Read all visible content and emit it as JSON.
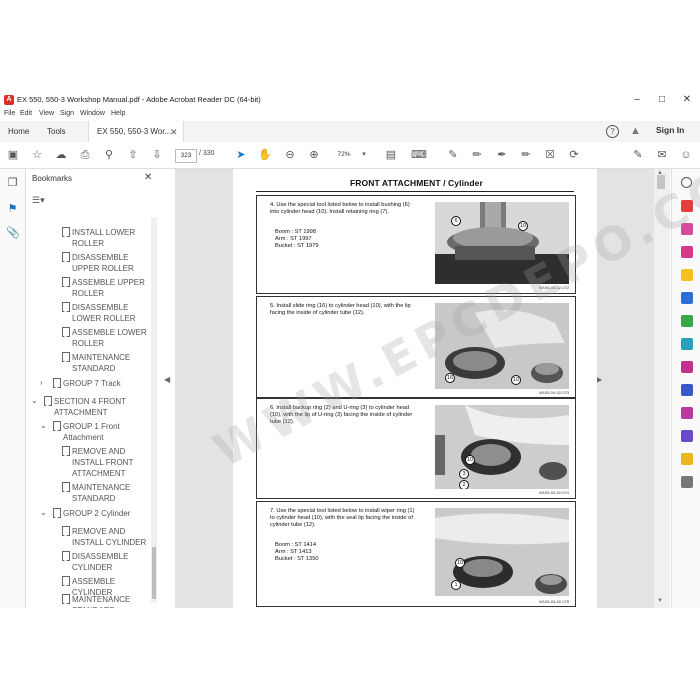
{
  "window": {
    "title": "EX 550, 550-3 Workshop Manual.pdf - Adobe Acrobat Reader DC (64-bit)",
    "minimize_icon": "minimize-icon",
    "maximize_icon": "maximize-icon",
    "close_icon": "close-icon"
  },
  "menu": [
    "File",
    "Edit",
    "View",
    "Sign",
    "Window",
    "Help"
  ],
  "tabs": {
    "home": "Home",
    "tools": "Tools",
    "document": "EX 550, 550-3 Wor...",
    "sign_in": "Sign In"
  },
  "toolbar": {
    "page_current": "323",
    "page_total": "/ 330",
    "zoom": "72%"
  },
  "bookmarks": {
    "title": "Bookmarks",
    "items": [
      {
        "label": "INSTALL LOWER ROLLER"
      },
      {
        "label": "DISASSEMBLE UPPER ROLLER"
      },
      {
        "label": "ASSEMBLE UPPER ROLLER"
      },
      {
        "label": "DISASSEMBLE LOWER ROLLER"
      },
      {
        "label": "ASSEMBLE LOWER ROLLER"
      },
      {
        "label": "MAINTENANCE STANDARD"
      },
      {
        "label": "GROUP 7 Track"
      },
      {
        "label": "SECTION 4 FRONT ATTACHMENT"
      },
      {
        "label": "GROUP 1 Front Attachment"
      },
      {
        "label": "REMOVE AND INSTALL FRONT ATTACHMENT"
      },
      {
        "label": "MAINTENANCE STANDARD"
      },
      {
        "label": "GROUP 2 Cylinder"
      },
      {
        "label": "REMOVE AND INSTALL CYLINDER"
      },
      {
        "label": "DISASSEMBLE CYLINDER"
      },
      {
        "label": "ASSEMBLE CYLINDER"
      },
      {
        "label": "MAINTENANCE STANDARD"
      }
    ]
  },
  "document": {
    "header": "FRONT ATTACHMENT / Cylinder",
    "steps": [
      {
        "text": "4. Use the special tool listed below to install bushing (6) into cylinder head (10). Install retaining ring (7).",
        "tools": [
          "Boom   : ST 1998",
          "Arm     : ST 1997",
          "Bucket : ST 1979"
        ],
        "callouts": [
          "6",
          "10"
        ],
        "caption": "W105-04-02-072"
      },
      {
        "text": "5. Install slide ring (16) to cylinder head (10), with the lip facing the inside of cylinder tube (12).",
        "tools": [],
        "callouts": [
          "16",
          "10"
        ],
        "caption": "W105-04-02-073"
      },
      {
        "text": "6. Install backup ring (2) and U-ring (3) to cylinder head (10), with the lip of U-ring (3) facing the inside of cylinder tube (12).",
        "tools": [],
        "callouts": [
          "10",
          "3",
          "2"
        ],
        "caption": "W105-04-02-074"
      },
      {
        "text": "7. Use the special tool listed below to install wiper ring (1) to cylinder head (10), with the seal lip facing the inside of cylinder tube (12).",
        "tools": [
          "Boom   : ST 1414",
          "Arm     : ST 1413",
          "Bucket : ST 1350"
        ],
        "callouts": [
          "10",
          "1"
        ],
        "caption": "W105-04-02-075"
      }
    ],
    "watermark": "WWW.EPCDEPO.COM"
  }
}
